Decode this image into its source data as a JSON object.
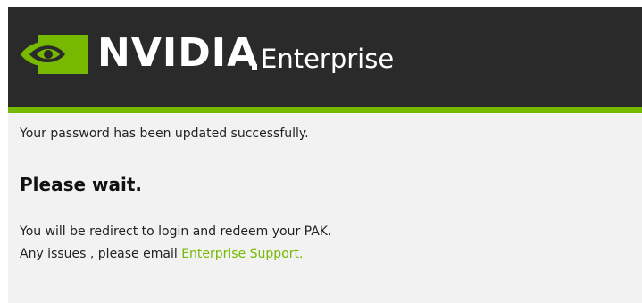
{
  "header": {
    "logo_icon": "nvidia-eye-icon",
    "brand_name": "NVIDIA",
    "brand_suffix": "Enterprise",
    "background_color": "#2a2a2a",
    "accent_color": "#76b900"
  },
  "message": {
    "success_text": "Your password has been updated successfully.",
    "wait_heading": "Please wait.",
    "redirect_text": "You will be redirect to login and redeem your PAK.",
    "issues_prefix": "Any issues , please email ",
    "support_link_label": "Enterprise Support."
  }
}
